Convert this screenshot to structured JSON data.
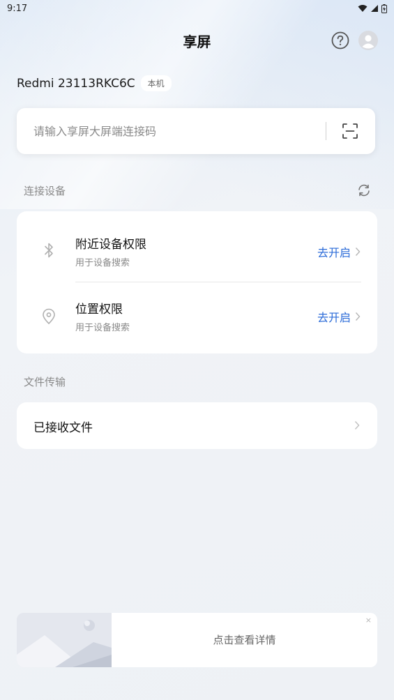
{
  "status_bar": {
    "time": "9:17"
  },
  "header": {
    "title": "享屏"
  },
  "device": {
    "name": "Redmi 23113RKC6C",
    "badge": "本机"
  },
  "connect_input": {
    "placeholder": "请输入享屏大屏端连接码",
    "value": ""
  },
  "connect_section": {
    "label": "连接设备",
    "items": [
      {
        "title": "附近设备权限",
        "subtitle": "用于设备搜索",
        "action": "去开启",
        "icon": "bluetooth-icon"
      },
      {
        "title": "位置权限",
        "subtitle": "用于设备搜索",
        "action": "去开启",
        "icon": "location-pin-icon"
      }
    ]
  },
  "file_section": {
    "label": "文件传输",
    "received_files": "已接收文件"
  },
  "banner": {
    "text": "点击查看详情",
    "close": "×"
  },
  "colors": {
    "accent": "#2b6bd8",
    "background": "#eef1f5",
    "card": "#ffffff",
    "muted": "#8a8a8a"
  }
}
